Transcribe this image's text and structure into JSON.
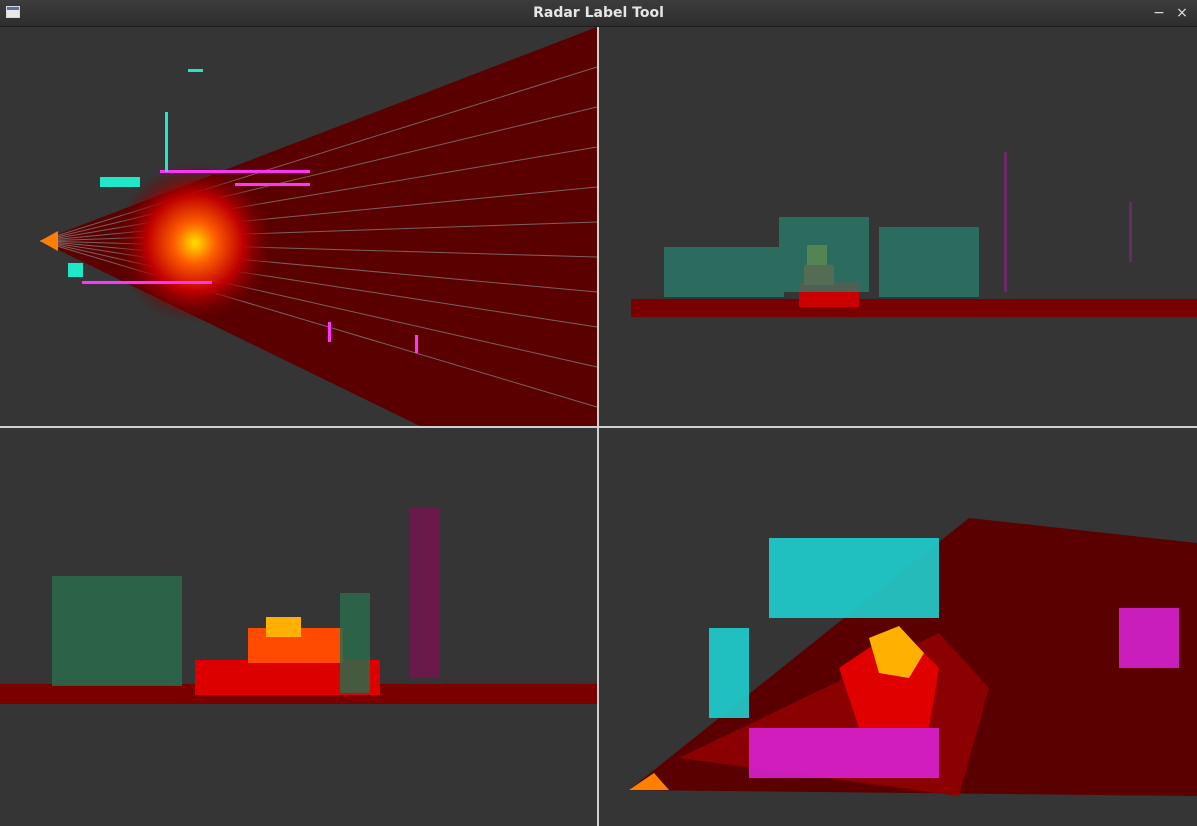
{
  "window": {
    "title": "Radar Label Tool",
    "icon": "app-window-icon",
    "minimize_glyph": "−",
    "close_glyph": "×"
  },
  "views": [
    {
      "id": "top",
      "content": "radar-fan-top-view"
    },
    {
      "id": "front",
      "content": "radar-point-cloud-front-view"
    },
    {
      "id": "side",
      "content": "radar-point-cloud-side-view"
    },
    {
      "id": "perspective",
      "content": "radar-point-cloud-3d-view"
    }
  ],
  "colors": {
    "background": "#353535",
    "radar_dark": "#3a0000",
    "radar_mid": "#8b0000",
    "radar_hot": "#ff2a00",
    "radar_peak": "#ffd000",
    "lidar_cyan": "#00e5e5",
    "lidar_magenta": "#ff00ff",
    "lidar_green": "#1fdf5f"
  }
}
